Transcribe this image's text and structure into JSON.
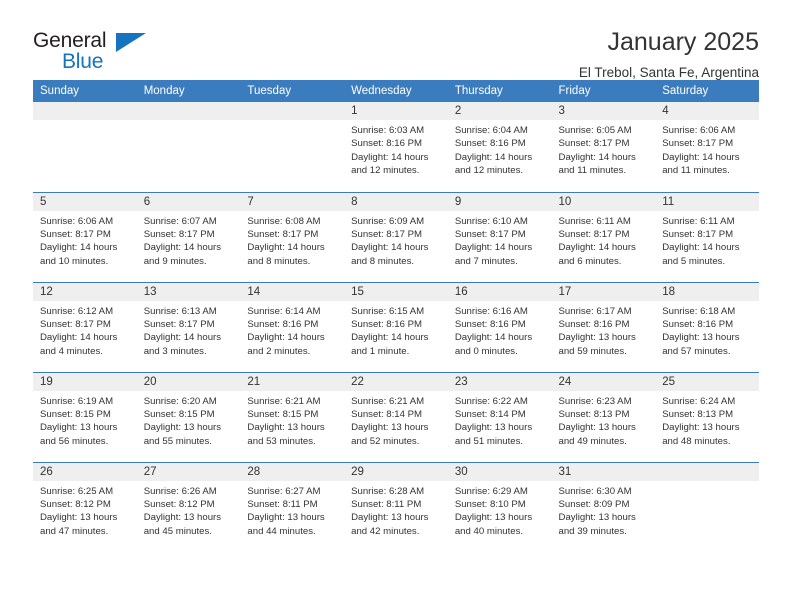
{
  "brand": {
    "name_top": "General",
    "name_bottom": "Blue",
    "flag_icon": "blue-triangle-icon",
    "accent_color": "#1673c0"
  },
  "header": {
    "title": "January 2025",
    "subtitle": "El Trebol, Santa Fe, Argentina"
  },
  "theme": {
    "header_row_color": "#3b7cbe",
    "daynum_background": "#efefef",
    "text_color": "#333333"
  },
  "calendar": {
    "weekday_headers": [
      "Sunday",
      "Monday",
      "Tuesday",
      "Wednesday",
      "Thursday",
      "Friday",
      "Saturday"
    ],
    "labels": {
      "sunrise_prefix": "Sunrise:",
      "sunset_prefix": "Sunset:",
      "daylight_prefix": "Daylight:"
    },
    "weeks": [
      [
        {
          "day": "",
          "lines": [
            "",
            "",
            "",
            ""
          ]
        },
        {
          "day": "",
          "lines": [
            "",
            "",
            "",
            ""
          ]
        },
        {
          "day": "",
          "lines": [
            "",
            "",
            "",
            ""
          ]
        },
        {
          "day": "1",
          "lines": [
            "Sunrise: 6:03 AM",
            "Sunset: 8:16 PM",
            "Daylight: 14 hours",
            "and 12 minutes."
          ]
        },
        {
          "day": "2",
          "lines": [
            "Sunrise: 6:04 AM",
            "Sunset: 8:16 PM",
            "Daylight: 14 hours",
            "and 12 minutes."
          ]
        },
        {
          "day": "3",
          "lines": [
            "Sunrise: 6:05 AM",
            "Sunset: 8:17 PM",
            "Daylight: 14 hours",
            "and 11 minutes."
          ]
        },
        {
          "day": "4",
          "lines": [
            "Sunrise: 6:06 AM",
            "Sunset: 8:17 PM",
            "Daylight: 14 hours",
            "and 11 minutes."
          ]
        }
      ],
      [
        {
          "day": "5",
          "lines": [
            "Sunrise: 6:06 AM",
            "Sunset: 8:17 PM",
            "Daylight: 14 hours",
            "and 10 minutes."
          ]
        },
        {
          "day": "6",
          "lines": [
            "Sunrise: 6:07 AM",
            "Sunset: 8:17 PM",
            "Daylight: 14 hours",
            "and 9 minutes."
          ]
        },
        {
          "day": "7",
          "lines": [
            "Sunrise: 6:08 AM",
            "Sunset: 8:17 PM",
            "Daylight: 14 hours",
            "and 8 minutes."
          ]
        },
        {
          "day": "8",
          "lines": [
            "Sunrise: 6:09 AM",
            "Sunset: 8:17 PM",
            "Daylight: 14 hours",
            "and 8 minutes."
          ]
        },
        {
          "day": "9",
          "lines": [
            "Sunrise: 6:10 AM",
            "Sunset: 8:17 PM",
            "Daylight: 14 hours",
            "and 7 minutes."
          ]
        },
        {
          "day": "10",
          "lines": [
            "Sunrise: 6:11 AM",
            "Sunset: 8:17 PM",
            "Daylight: 14 hours",
            "and 6 minutes."
          ]
        },
        {
          "day": "11",
          "lines": [
            "Sunrise: 6:11 AM",
            "Sunset: 8:17 PM",
            "Daylight: 14 hours",
            "and 5 minutes."
          ]
        }
      ],
      [
        {
          "day": "12",
          "lines": [
            "Sunrise: 6:12 AM",
            "Sunset: 8:17 PM",
            "Daylight: 14 hours",
            "and 4 minutes."
          ]
        },
        {
          "day": "13",
          "lines": [
            "Sunrise: 6:13 AM",
            "Sunset: 8:17 PM",
            "Daylight: 14 hours",
            "and 3 minutes."
          ]
        },
        {
          "day": "14",
          "lines": [
            "Sunrise: 6:14 AM",
            "Sunset: 8:16 PM",
            "Daylight: 14 hours",
            "and 2 minutes."
          ]
        },
        {
          "day": "15",
          "lines": [
            "Sunrise: 6:15 AM",
            "Sunset: 8:16 PM",
            "Daylight: 14 hours",
            "and 1 minute."
          ]
        },
        {
          "day": "16",
          "lines": [
            "Sunrise: 6:16 AM",
            "Sunset: 8:16 PM",
            "Daylight: 14 hours",
            "and 0 minutes."
          ]
        },
        {
          "day": "17",
          "lines": [
            "Sunrise: 6:17 AM",
            "Sunset: 8:16 PM",
            "Daylight: 13 hours",
            "and 59 minutes."
          ]
        },
        {
          "day": "18",
          "lines": [
            "Sunrise: 6:18 AM",
            "Sunset: 8:16 PM",
            "Daylight: 13 hours",
            "and 57 minutes."
          ]
        }
      ],
      [
        {
          "day": "19",
          "lines": [
            "Sunrise: 6:19 AM",
            "Sunset: 8:15 PM",
            "Daylight: 13 hours",
            "and 56 minutes."
          ]
        },
        {
          "day": "20",
          "lines": [
            "Sunrise: 6:20 AM",
            "Sunset: 8:15 PM",
            "Daylight: 13 hours",
            "and 55 minutes."
          ]
        },
        {
          "day": "21",
          "lines": [
            "Sunrise: 6:21 AM",
            "Sunset: 8:15 PM",
            "Daylight: 13 hours",
            "and 53 minutes."
          ]
        },
        {
          "day": "22",
          "lines": [
            "Sunrise: 6:21 AM",
            "Sunset: 8:14 PM",
            "Daylight: 13 hours",
            "and 52 minutes."
          ]
        },
        {
          "day": "23",
          "lines": [
            "Sunrise: 6:22 AM",
            "Sunset: 8:14 PM",
            "Daylight: 13 hours",
            "and 51 minutes."
          ]
        },
        {
          "day": "24",
          "lines": [
            "Sunrise: 6:23 AM",
            "Sunset: 8:13 PM",
            "Daylight: 13 hours",
            "and 49 minutes."
          ]
        },
        {
          "day": "25",
          "lines": [
            "Sunrise: 6:24 AM",
            "Sunset: 8:13 PM",
            "Daylight: 13 hours",
            "and 48 minutes."
          ]
        }
      ],
      [
        {
          "day": "26",
          "lines": [
            "Sunrise: 6:25 AM",
            "Sunset: 8:12 PM",
            "Daylight: 13 hours",
            "and 47 minutes."
          ]
        },
        {
          "day": "27",
          "lines": [
            "Sunrise: 6:26 AM",
            "Sunset: 8:12 PM",
            "Daylight: 13 hours",
            "and 45 minutes."
          ]
        },
        {
          "day": "28",
          "lines": [
            "Sunrise: 6:27 AM",
            "Sunset: 8:11 PM",
            "Daylight: 13 hours",
            "and 44 minutes."
          ]
        },
        {
          "day": "29",
          "lines": [
            "Sunrise: 6:28 AM",
            "Sunset: 8:11 PM",
            "Daylight: 13 hours",
            "and 42 minutes."
          ]
        },
        {
          "day": "30",
          "lines": [
            "Sunrise: 6:29 AM",
            "Sunset: 8:10 PM",
            "Daylight: 13 hours",
            "and 40 minutes."
          ]
        },
        {
          "day": "31",
          "lines": [
            "Sunrise: 6:30 AM",
            "Sunset: 8:09 PM",
            "Daylight: 13 hours",
            "and 39 minutes."
          ]
        },
        {
          "day": "",
          "lines": [
            "",
            "",
            "",
            ""
          ]
        }
      ]
    ]
  }
}
